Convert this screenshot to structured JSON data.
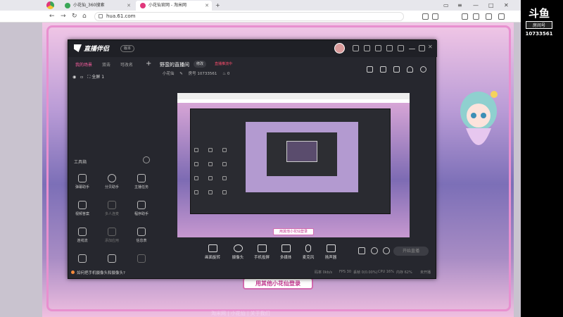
{
  "browser": {
    "tabs": [
      {
        "label": "小花仙_360搜索",
        "color": "#3aa757"
      },
      {
        "label": "小花仙官网 - 淘米网",
        "color": "#e0377b"
      }
    ],
    "url": "hua.61.com"
  },
  "app": {
    "version_badge": "版本",
    "left_tabs": [
      "我的场景",
      "双击",
      "可改名"
    ],
    "scene_item": "全屏 1",
    "tools_title": "工具箱",
    "tools": [
      {
        "label": "弹幕助手",
        "icon": "chat-icon"
      },
      {
        "label": "分贝助手",
        "icon": "user-icon"
      },
      {
        "label": "主播任务",
        "icon": "task-icon"
      },
      {
        "label": "视频答案",
        "icon": "video-icon"
      },
      {
        "label": "多人连麦",
        "icon": "download-icon"
      },
      {
        "label": "程序助手",
        "icon": "program-icon"
      },
      {
        "label": "连线流",
        "icon": "link-icon"
      },
      {
        "label": "添加应用",
        "icon": "download-icon"
      },
      {
        "label": "信息表",
        "icon": "calendar-icon"
      },
      {
        "label": "",
        "icon": "doc-icon"
      },
      {
        "label": "",
        "icon": "image-icon"
      },
      {
        "label": "",
        "icon": "download-icon"
      }
    ],
    "tip": "如何把手机摄像头和摄像头?",
    "room_title": "野蛮的直播间",
    "edit_tag": "修改",
    "live_tag": "直播推流中",
    "category": "小花仙",
    "room_id": "房号 10733561",
    "heat": "0",
    "preview_banner": "用其他小花仙登录",
    "controls": [
      "画面旋转",
      "摄像头",
      "手机投屏",
      "多媒体",
      "麦克风",
      "扬声器"
    ],
    "go_live": "开始直播",
    "status": [
      "码率 0kb/s",
      "FPS 30",
      "丢帧 0(0.00%)",
      "CPU 16%",
      "内存 62%",
      "未开播"
    ]
  },
  "page": {
    "banner": "用其他小花仙登录",
    "footer": "淘米网 | 小花仙 | 关于我们"
  },
  "douyu": {
    "logo": "斗鱼",
    "sub": "房间号",
    "room": "10733561"
  }
}
